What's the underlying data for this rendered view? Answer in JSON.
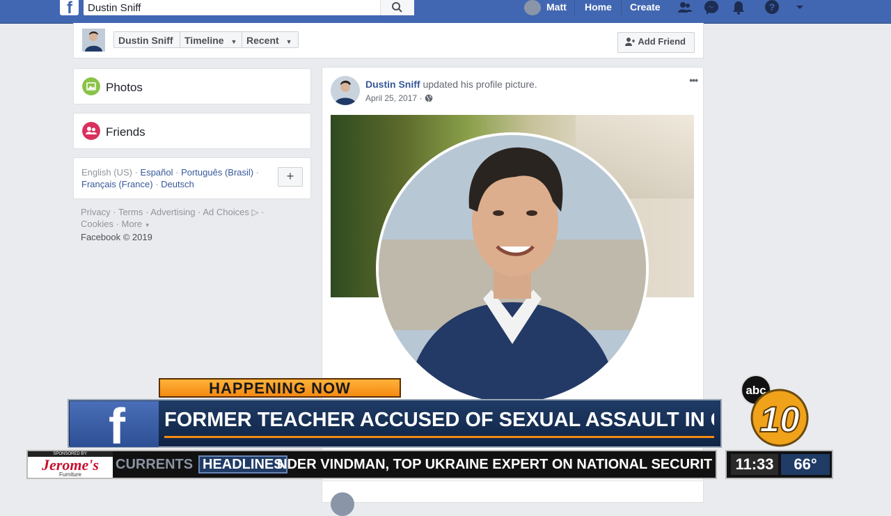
{
  "topbar": {
    "search_value": "Dustin Sniff",
    "user_name": "Matt",
    "home": "Home",
    "create": "Create"
  },
  "cover_nav": {
    "name": "Dustin Sniff",
    "timeline": "Timeline",
    "recent": "Recent",
    "add_friend": "Add Friend"
  },
  "left": {
    "photos": "Photos",
    "friends": "Friends",
    "languages": {
      "current": "English (US)",
      "sep": " · ",
      "spanish": "Español",
      "portuguese": "Português (Brasil)",
      "french": "Français (France)",
      "german": "Deutsch"
    },
    "add_language": "+",
    "footer": {
      "privacy": "Privacy",
      "terms": "Terms",
      "advertising": "Advertising",
      "ad_choices": "Ad Choices",
      "cookies": "Cookies",
      "more": "More",
      "copyright": "Facebook © 2019"
    }
  },
  "post": {
    "author": "Dustin Sniff",
    "action": "updated his profile picture.",
    "date": "April 25, 2017",
    "menu": "•••"
  },
  "broadcast": {
    "happening": "HAPPENING NOW",
    "headline": "FORMER TEACHER ACCUSED OF SEXUAL ASSAULT IN COURT",
    "sponsor_top": "SPONSORED BY:",
    "sponsor_name": "Jerome's",
    "sponsor_sub": "Furniture",
    "currents": "CURRENTS",
    "headlines": "HEADLINES",
    "ticker": "NDER VINDMAN, TOP UKRAINE EXPERT ON NATIONAL SECURIT",
    "time": "11:33",
    "temp": "66°",
    "station_abc": "abc",
    "station_num": "10"
  },
  "colors": {
    "facebook_blue": "#4267b2",
    "link_blue": "#365899",
    "chyron_orange": "#f58a12",
    "chyron_navy": "#1f3b66"
  }
}
